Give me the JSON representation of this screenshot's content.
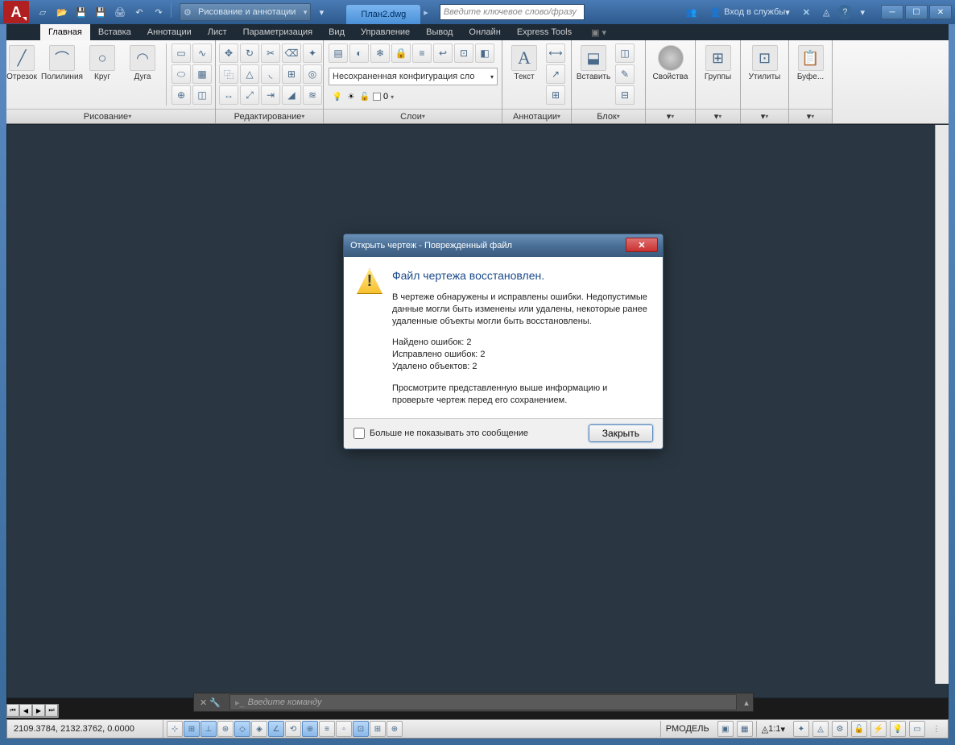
{
  "titlebar": {
    "workspace": "Рисование и аннотации",
    "document": "План2.dwg",
    "search_placeholder": "Введите ключевое слово/фразу",
    "signin": "Вход в службы"
  },
  "menus": [
    "Главная",
    "Вставка",
    "Аннотации",
    "Лист",
    "Параметризация",
    "Вид",
    "Управление",
    "Вывод",
    "Онлайн",
    "Express Tools"
  ],
  "active_menu": 0,
  "ribbon": {
    "draw": {
      "title": "Рисование",
      "btns": [
        "Отрезок",
        "Полилиния",
        "Круг",
        "Дуга"
      ]
    },
    "edit": {
      "title": "Редактирование"
    },
    "layers": {
      "title": "Слои",
      "combo": "Несохраненная конфигурация сло",
      "status": "0"
    },
    "annot": {
      "title": "Аннотации",
      "btn": "Текст"
    },
    "block": {
      "title": "Блок",
      "btn": "Вставить"
    },
    "props": {
      "title": "Свойства"
    },
    "groups": {
      "title": "Группы"
    },
    "utils": {
      "title": "Утилиты"
    },
    "clip": {
      "title": "Буфе..."
    }
  },
  "dialog": {
    "title": "Открыть чертеж - Поврежденный файл",
    "heading": "Файл чертежа восстановлен.",
    "para1": "В чертеже обнаружены и исправлены ошибки. Недопустимые данные могли быть изменены или удалены, некоторые ранее удаленные объекты могли быть восстановлены.",
    "found": "Найдено ошибок:  2",
    "fixed": "Исправлено ошибок:  2",
    "deleted": "Удалено объектов:  2",
    "para2": "Просмотрите представленную выше информацию и проверьте чертеж перед его сохранением.",
    "dont_show": "Больше не показывать это сообщение",
    "close": "Закрыть"
  },
  "command": {
    "placeholder": "Введите команду"
  },
  "status": {
    "coords": "2109.3784, 2132.3762, 0.0000",
    "model": "РМОДЕЛЬ",
    "scale": "1:1"
  }
}
